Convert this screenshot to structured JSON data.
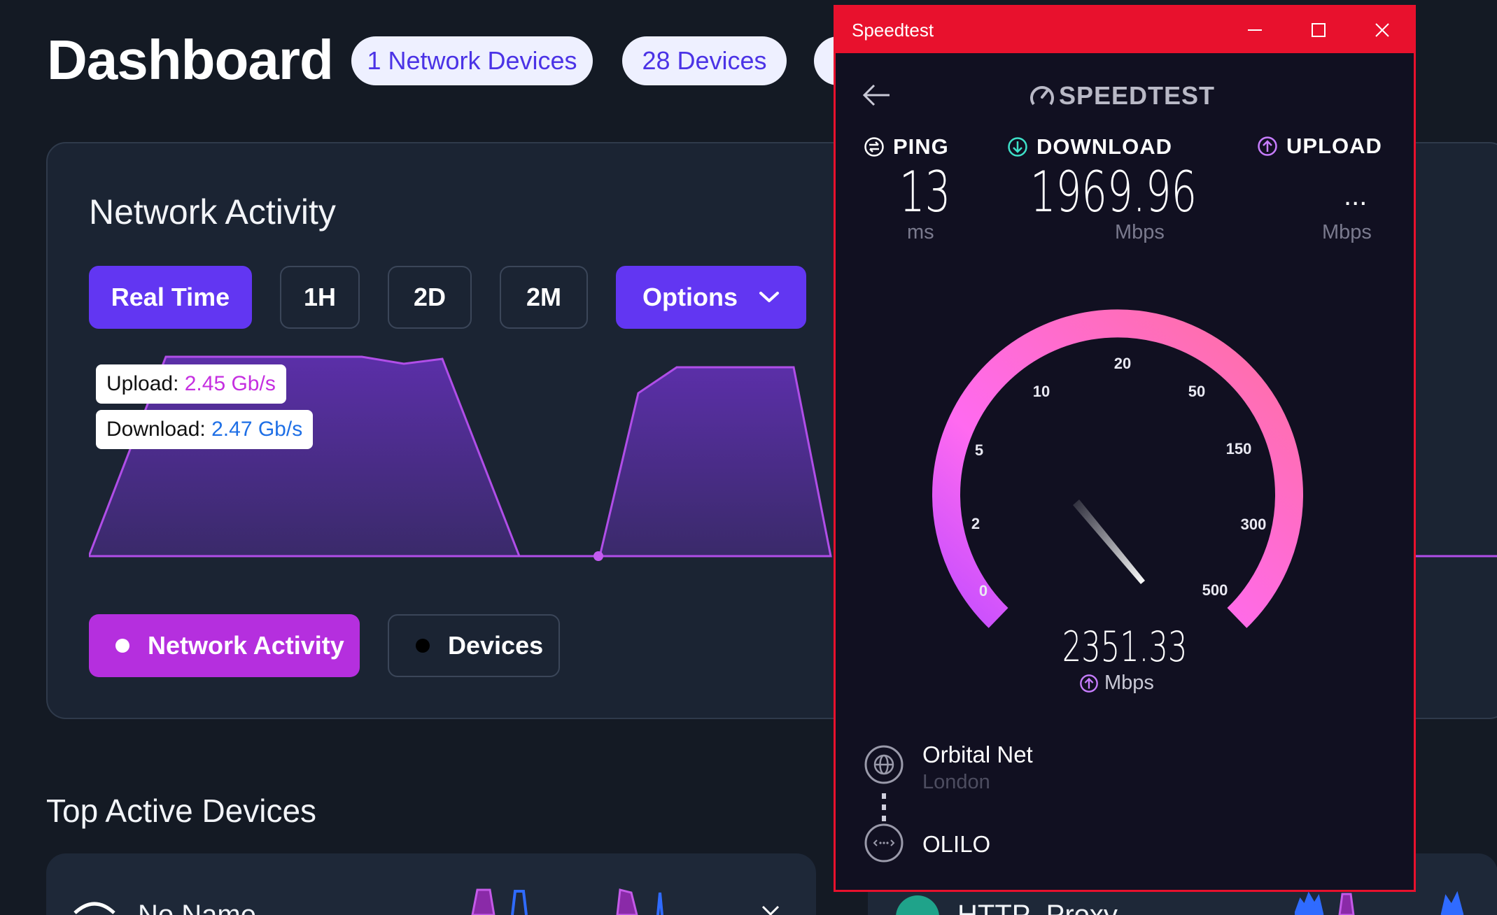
{
  "dashboard": {
    "title": "Dashboard",
    "pills": [
      "1 Network Devices",
      "28 Devices"
    ],
    "card": {
      "title": "Network Activity",
      "ranges": [
        "Real Time",
        "1H",
        "2D",
        "2M"
      ],
      "options_label": "Options",
      "tooltip": {
        "upload_label": "Upload:",
        "upload_value": "2.45 Gb/s",
        "download_label": "Download:",
        "download_value": "2.47 Gb/s"
      },
      "legend": [
        "Network Activity",
        "Devices"
      ]
    },
    "top_active": {
      "title": "Top Active Devices",
      "items": [
        "No Name",
        "HTTP_Proxy"
      ]
    },
    "colors": {
      "accent": "#6236f2",
      "legend_active": "#b52fde",
      "upload": "#c52fe0",
      "download": "#1e6fe6"
    }
  },
  "speedtest": {
    "window_title": "Speedtest",
    "brand": "SPEEDTEST",
    "ping": {
      "label": "PING",
      "value": "13",
      "unit": "ms"
    },
    "download": {
      "label": "DOWNLOAD",
      "value": "1969.96",
      "unit": "Mbps"
    },
    "upload": {
      "label": "UPLOAD",
      "value": "...",
      "unit": "Mbps"
    },
    "gauge": {
      "ticks": [
        "0",
        "2",
        "5",
        "10",
        "20",
        "50",
        "150",
        "300",
        "500"
      ],
      "current_value": "2351.33",
      "current_unit": "Mbps"
    },
    "server": {
      "name": "Orbital Net",
      "location": "London"
    },
    "provider": "OLILO",
    "colors": {
      "titlebar": "#e8112d",
      "background": "#111021",
      "gauge_start": "#c44dff",
      "gauge_end": "#ff6fa0"
    }
  }
}
